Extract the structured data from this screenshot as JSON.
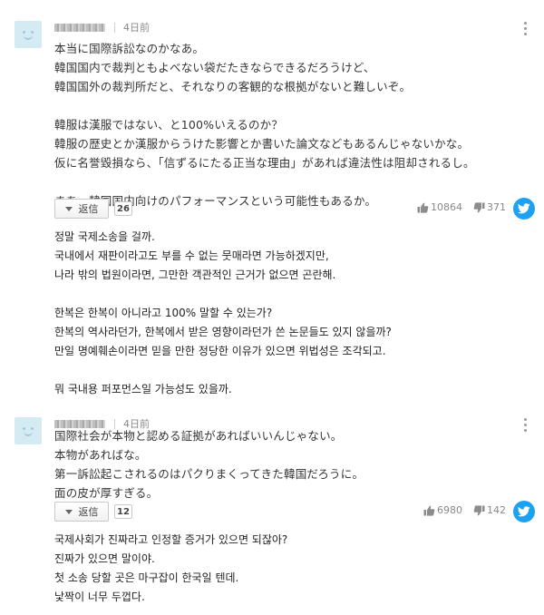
{
  "colors": {
    "avatar_bg": "#d4ebf4",
    "twitter_blue": "#1da1f2",
    "text": "#333333",
    "meta": "#888888"
  },
  "comments": [
    {
      "date": "4日前",
      "body_ja": "本当に国際訴訟なのかなあ。\n韓国国内で裁判ともよべない袋だたきならできるだろうけど、\n韓国国外の裁判所だと、それなりの客観的な根拠がないと難しいぞ。\n\n韓服は漢服ではない、と100%いえるのか？\n韓服の歴史とか漢服からうけた影響とか書いた論文などもあるんじゃないかな。\n仮に名誉毀損なら、「信ずるにたる正当な理由」があれば違法性は阻却されるし。\n\nまあ、韓国国内向けのパフォーマンスという可能性もあるか。",
      "reply_label": "返信",
      "reply_count": "26",
      "likes": "10864",
      "dislikes": "371",
      "body_ko": "정말 국제소송을 걸까.\n국내에서 재판이라고도 부를 수 없는 뭇매라면 가능하겠지만,\n나라 밖의 법원이라면, 그만한 객관적인 근거가 없으면 곤란해.\n\n한복은 한복이 아니라고 100% 말할 수 있는가?\n한복의 역사라던가, 한복에서 받은 영향이라던가 쓴 논문들도 있지 않을까?\n만일 명예훼손이라면 믿을 만한 정당한 이유가 있으면 위법성은 조각되고.\n\n뭐 국내용 퍼포먼스일 가능성도 있을까."
    },
    {
      "date": "4日前",
      "body_ja": "国際社会が本物と認める証拠があればいいんじゃない。\n本物があればな。\n第一訴訟起こされるのはパクりまくってきた韓国だろうに。\n面の皮が厚すぎる。",
      "reply_label": "返信",
      "reply_count": "12",
      "likes": "6980",
      "dislikes": "142",
      "body_ko": "국제사회가 진짜라고 인정할 증거가 있으면 되잖아?\n진짜가 있으면 말이야.\n첫 소송 당할 곳은 마구잡이 한국일 텐데.\n낯짝이 너무 두껍다."
    }
  ]
}
